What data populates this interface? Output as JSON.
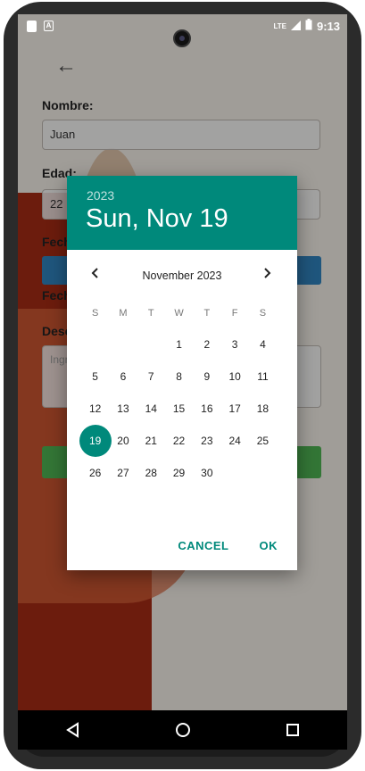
{
  "status": {
    "time": "9:13",
    "network": "LTE"
  },
  "form": {
    "name_label": "Nombre:",
    "name_value": "Juan",
    "age_label": "Edad:",
    "age_value": "22",
    "date1_label": "Fech",
    "date2_label": "Fech",
    "desc_label": "Desc",
    "desc_placeholder": "Ingr"
  },
  "date_picker": {
    "year": "2023",
    "selected_date": "Sun, Nov 19",
    "month_label": "November 2023",
    "weekdays": [
      "S",
      "M",
      "T",
      "W",
      "T",
      "F",
      "S"
    ],
    "leading_blanks": 3,
    "days": [
      "1",
      "2",
      "3",
      "4",
      "5",
      "6",
      "7",
      "8",
      "9",
      "10",
      "11",
      "12",
      "13",
      "14",
      "15",
      "16",
      "17",
      "18",
      "19",
      "20",
      "21",
      "22",
      "23",
      "24",
      "25",
      "26",
      "27",
      "28",
      "29",
      "30"
    ],
    "selected_day": "19",
    "cancel_label": "CANCEL",
    "ok_label": "OK",
    "accent_color": "#00897b"
  },
  "icons": {
    "back": "arrow-left-icon",
    "prev_month": "chevron-left-icon",
    "next_month": "chevron-right-icon",
    "nav_back": "triangle-back-icon",
    "nav_home": "circle-home-icon",
    "nav_recents": "square-recents-icon"
  }
}
